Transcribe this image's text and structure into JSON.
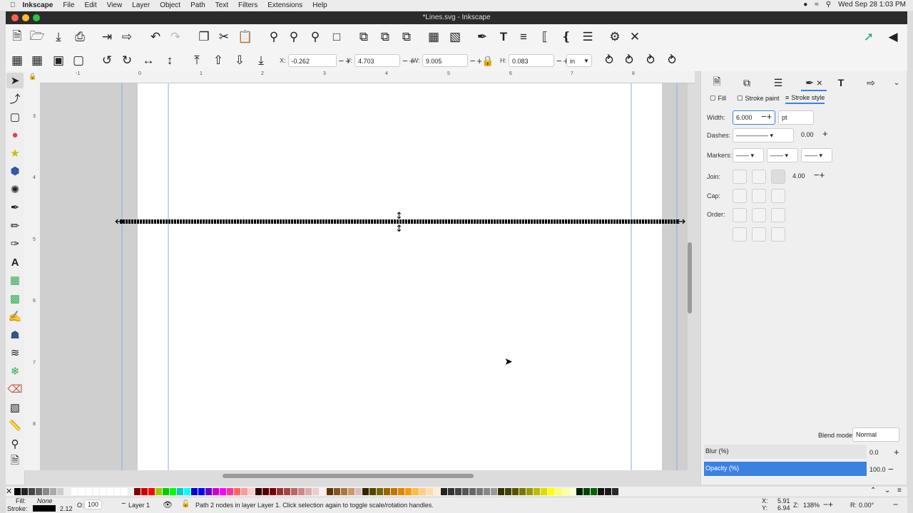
{
  "menubar": {
    "app": "Inkscape",
    "items": [
      "File",
      "Edit",
      "View",
      "Layer",
      "Object",
      "Path",
      "Text",
      "Filters",
      "Extensions",
      "Help"
    ],
    "clock": "Wed Sep 28  1:03 PM"
  },
  "window": {
    "title": "*Lines.svg - Inkscape"
  },
  "tool_controls": {
    "x_label": "X:",
    "x_value": "-0.262",
    "y_label": "Y:",
    "y_value": "4.703",
    "w_label": "W:",
    "w_value": "9.005",
    "h_label": "H:",
    "h_value": "0.083",
    "unit": "in"
  },
  "rulers": {
    "h_ticks": [
      "-1",
      "0",
      "1",
      "2",
      "3",
      "4",
      "5",
      "6",
      "7",
      "8"
    ],
    "v_ticks": [
      "3",
      "4",
      "5",
      "6",
      "7",
      "8"
    ]
  },
  "fill_stroke": {
    "tabs": [
      "Fill",
      "Stroke paint",
      "Stroke style"
    ],
    "width_label": "Width:",
    "width_value": "6.000",
    "width_unit": "pt",
    "dashes_label": "Dashes:",
    "dash_offset": "0.00",
    "markers_label": "Markers:",
    "join_label": "Join:",
    "miter_limit": "4.00",
    "cap_label": "Cap:",
    "order_label": "Order:",
    "blend_label": "Blend mode:",
    "blend_value": "Normal",
    "blur_label": "Blur (%)",
    "blur_value": "0.0",
    "opacity_label": "Opacity (%)",
    "opacity_value": "100.0"
  },
  "status": {
    "fill_label": "Fill:",
    "fill_value": "None",
    "stroke_label": "Stroke:",
    "stroke_width": "2.12",
    "opacity_label": "O:",
    "opacity_value": "100",
    "layer": "Layer 1",
    "message": "Path 2 nodes in layer Layer 1. Click selection again to toggle scale/rotation handles.",
    "cursor_x_label": "X:",
    "cursor_x": "5.91",
    "cursor_y_label": "Y:",
    "cursor_y": "6.94",
    "zoom_label": "Z:",
    "zoom": "138%",
    "rotation_label": "R:",
    "rotation": "0.00°"
  },
  "colors": {
    "accent": "#3b82e0",
    "stroke_line": "#000000"
  }
}
